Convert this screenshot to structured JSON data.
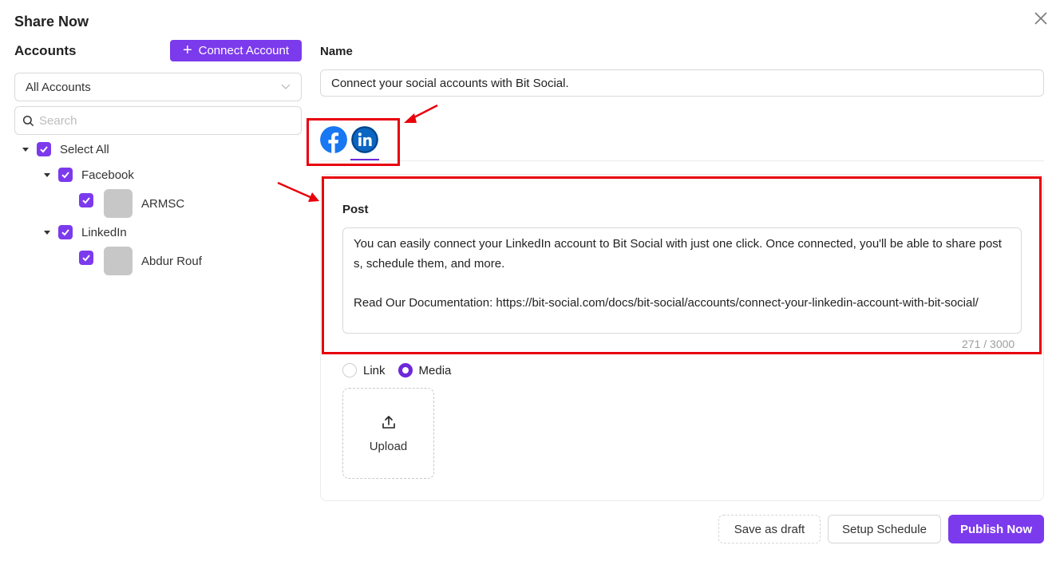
{
  "modal": {
    "title": "Share Now"
  },
  "accounts": {
    "title": "Accounts",
    "connect_label": "Connect Account",
    "filter_value": "All Accounts",
    "search_placeholder": "Search",
    "tree": {
      "select_all": "Select All",
      "groups": [
        {
          "label": "Facebook",
          "accounts": [
            {
              "label": "ARMSC"
            }
          ]
        },
        {
          "label": "LinkedIn",
          "accounts": [
            {
              "label": "Abdur Rouf"
            }
          ]
        }
      ]
    }
  },
  "form": {
    "name_label": "Name",
    "name_value": "Connect your social accounts with Bit Social.",
    "networks": [
      "facebook-icon",
      "linkedin-icon"
    ],
    "active_network": "linkedin",
    "post_label": "Post",
    "post_text": "You can easily connect your LinkedIn account to Bit Social with just one click. Once connected, you'll be able to share posts, schedule them, and more.\n\nRead Our Documentation: https://bit-social.com/docs/bit-social/accounts/connect-your-linkedin-account-with-bit-social/",
    "char_count": "271 / 3000",
    "attachment": {
      "link_label": "Link",
      "media_label": "Media",
      "selected": "Media"
    },
    "upload_label": "Upload"
  },
  "footer": {
    "draft_label": "Save as draft",
    "schedule_label": "Setup Schedule",
    "publish_label": "Publish Now"
  },
  "colors": {
    "accent": "#7c3aed",
    "annotation": "#e8000b",
    "facebook": "#1877f2",
    "linkedin": "#0a66c2"
  }
}
